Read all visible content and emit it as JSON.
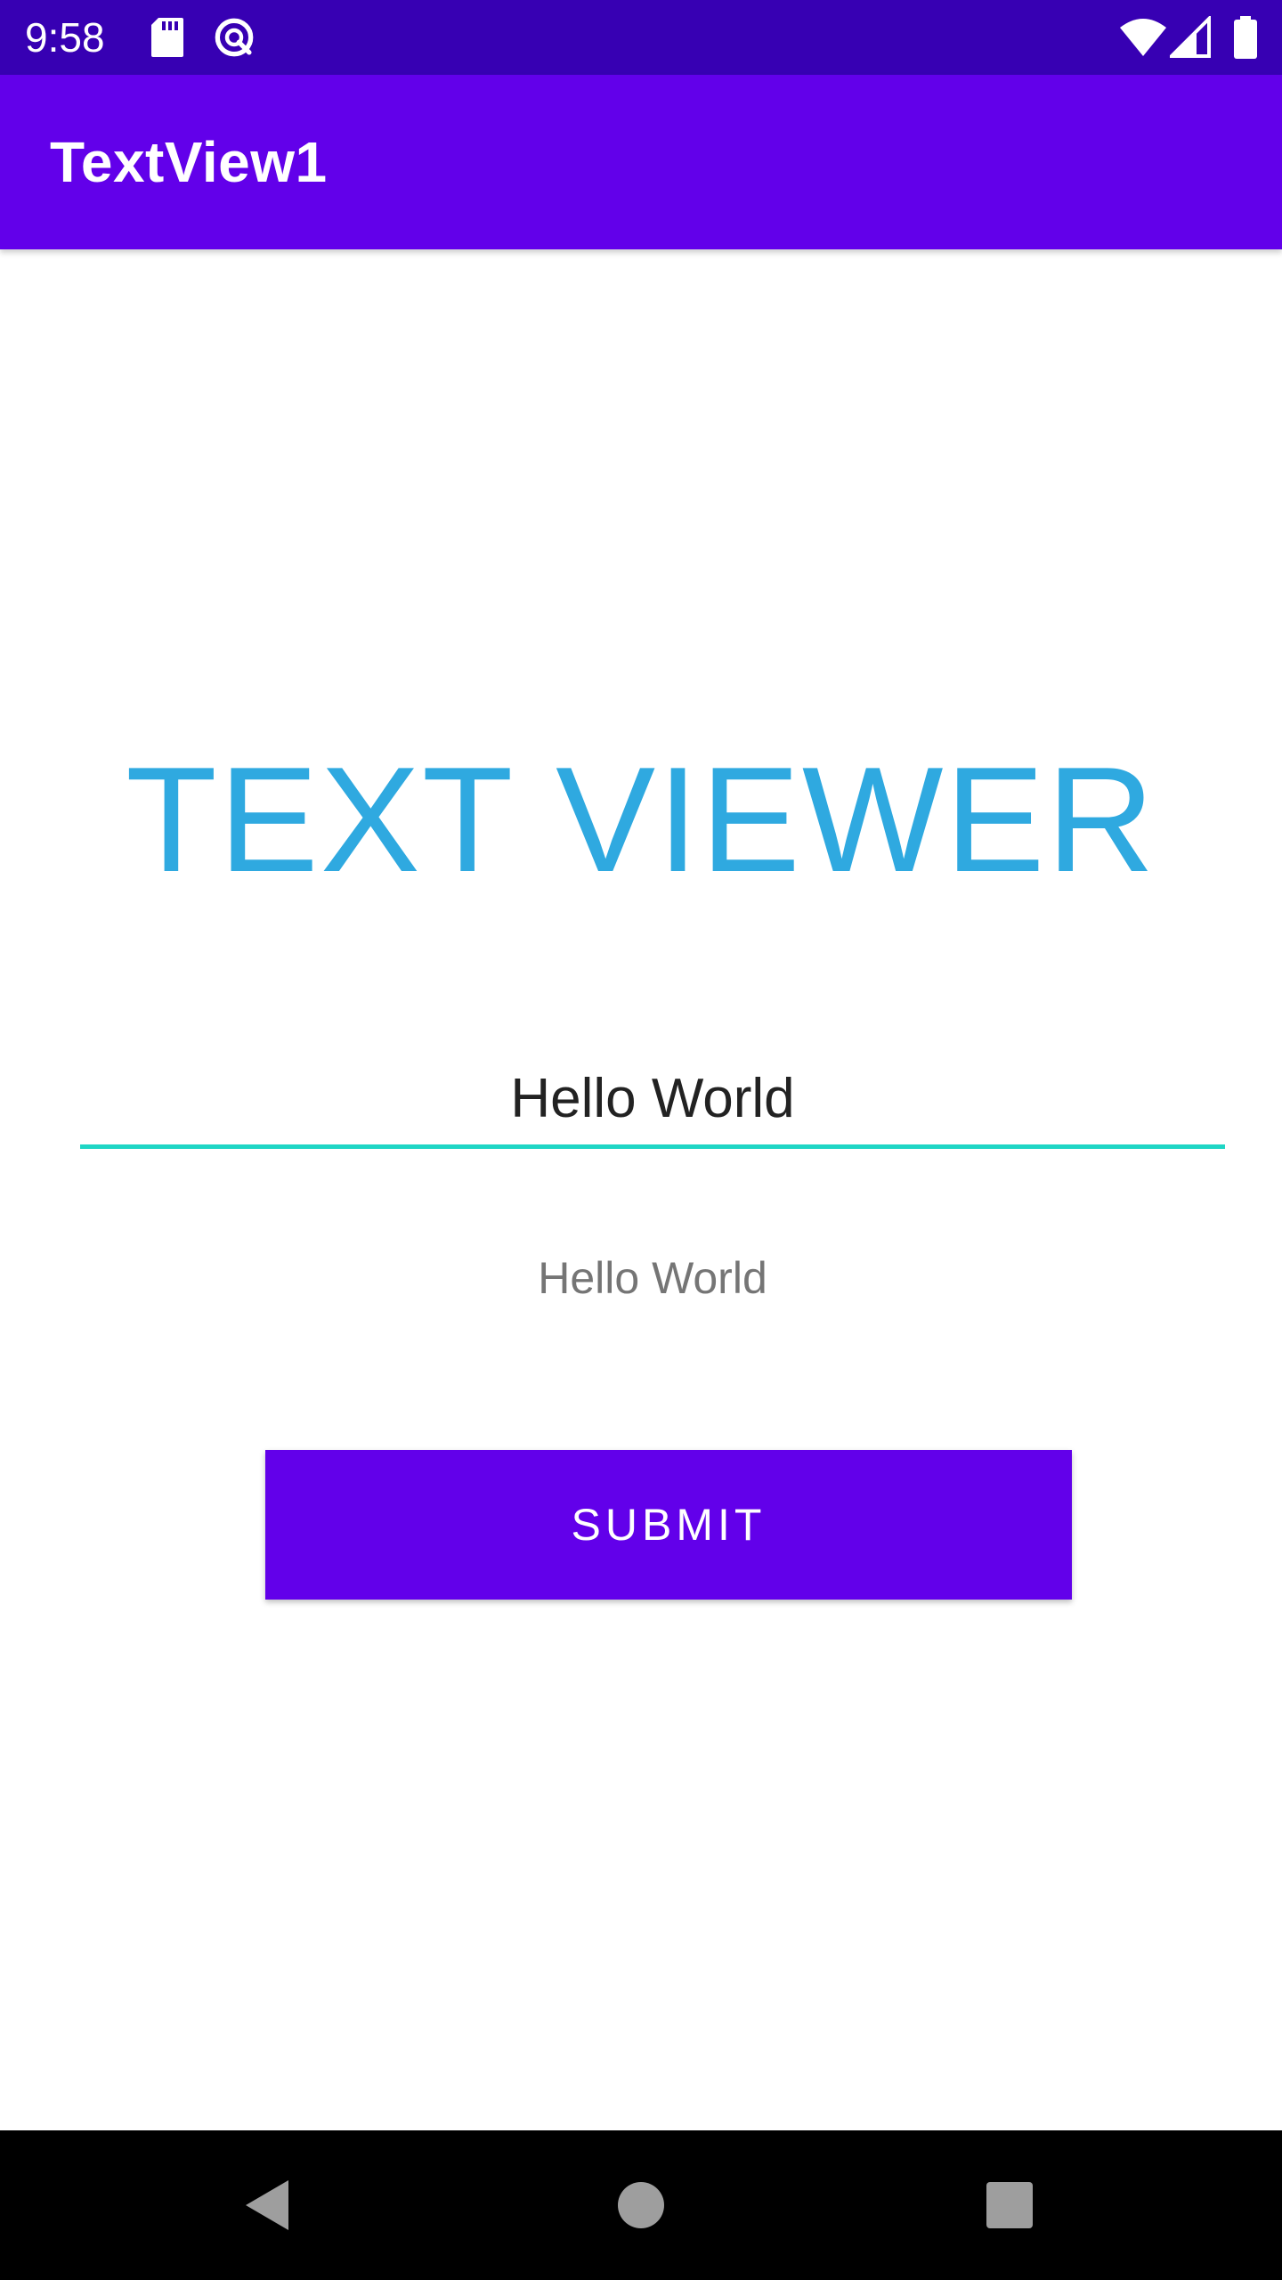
{
  "status_bar": {
    "time": "9:58",
    "icons": [
      "sd-card-icon",
      "data-saver-icon",
      "wifi-icon",
      "signal-icon",
      "battery-icon"
    ]
  },
  "app_bar": {
    "title": "TextView1"
  },
  "main": {
    "heading": "TEXT VIEWER",
    "input_value": "Hello World",
    "output_text": "Hello World",
    "submit_label": "SUBMIT"
  },
  "nav_bar": {
    "icons": [
      "back-icon",
      "home-icon",
      "recents-icon"
    ]
  },
  "colors": {
    "status_bar": "#3700b3",
    "primary": "#6200ea",
    "heading": "#2fa9e0",
    "input_underline": "#1fd6c5",
    "output_text": "#757575"
  }
}
